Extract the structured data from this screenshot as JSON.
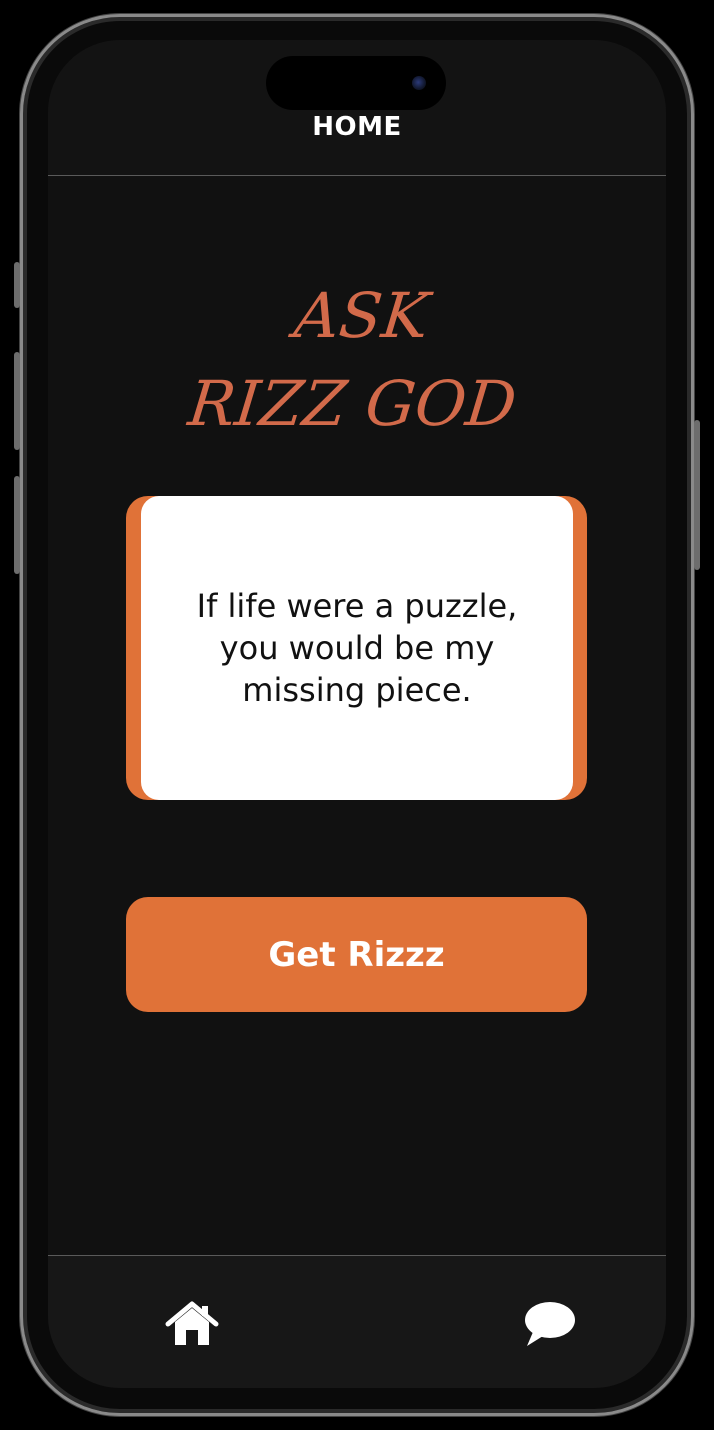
{
  "header": {
    "title": "HOME"
  },
  "hero": {
    "line1": "ASK",
    "line2": "RIZZ GOD",
    "color": "#d26a4a"
  },
  "rizz_card": {
    "text": "If life were a puzzle, you would be my missing piece."
  },
  "actions": {
    "get_rizz_label": "Get Rizzz",
    "accent_color": "#e07238"
  },
  "tabbar": {
    "items": [
      {
        "icon": "home-icon"
      },
      {
        "icon": "chat-bubble-icon"
      }
    ]
  },
  "colors": {
    "background": "#111111",
    "card": "#ffffff",
    "accent": "#e07238"
  }
}
